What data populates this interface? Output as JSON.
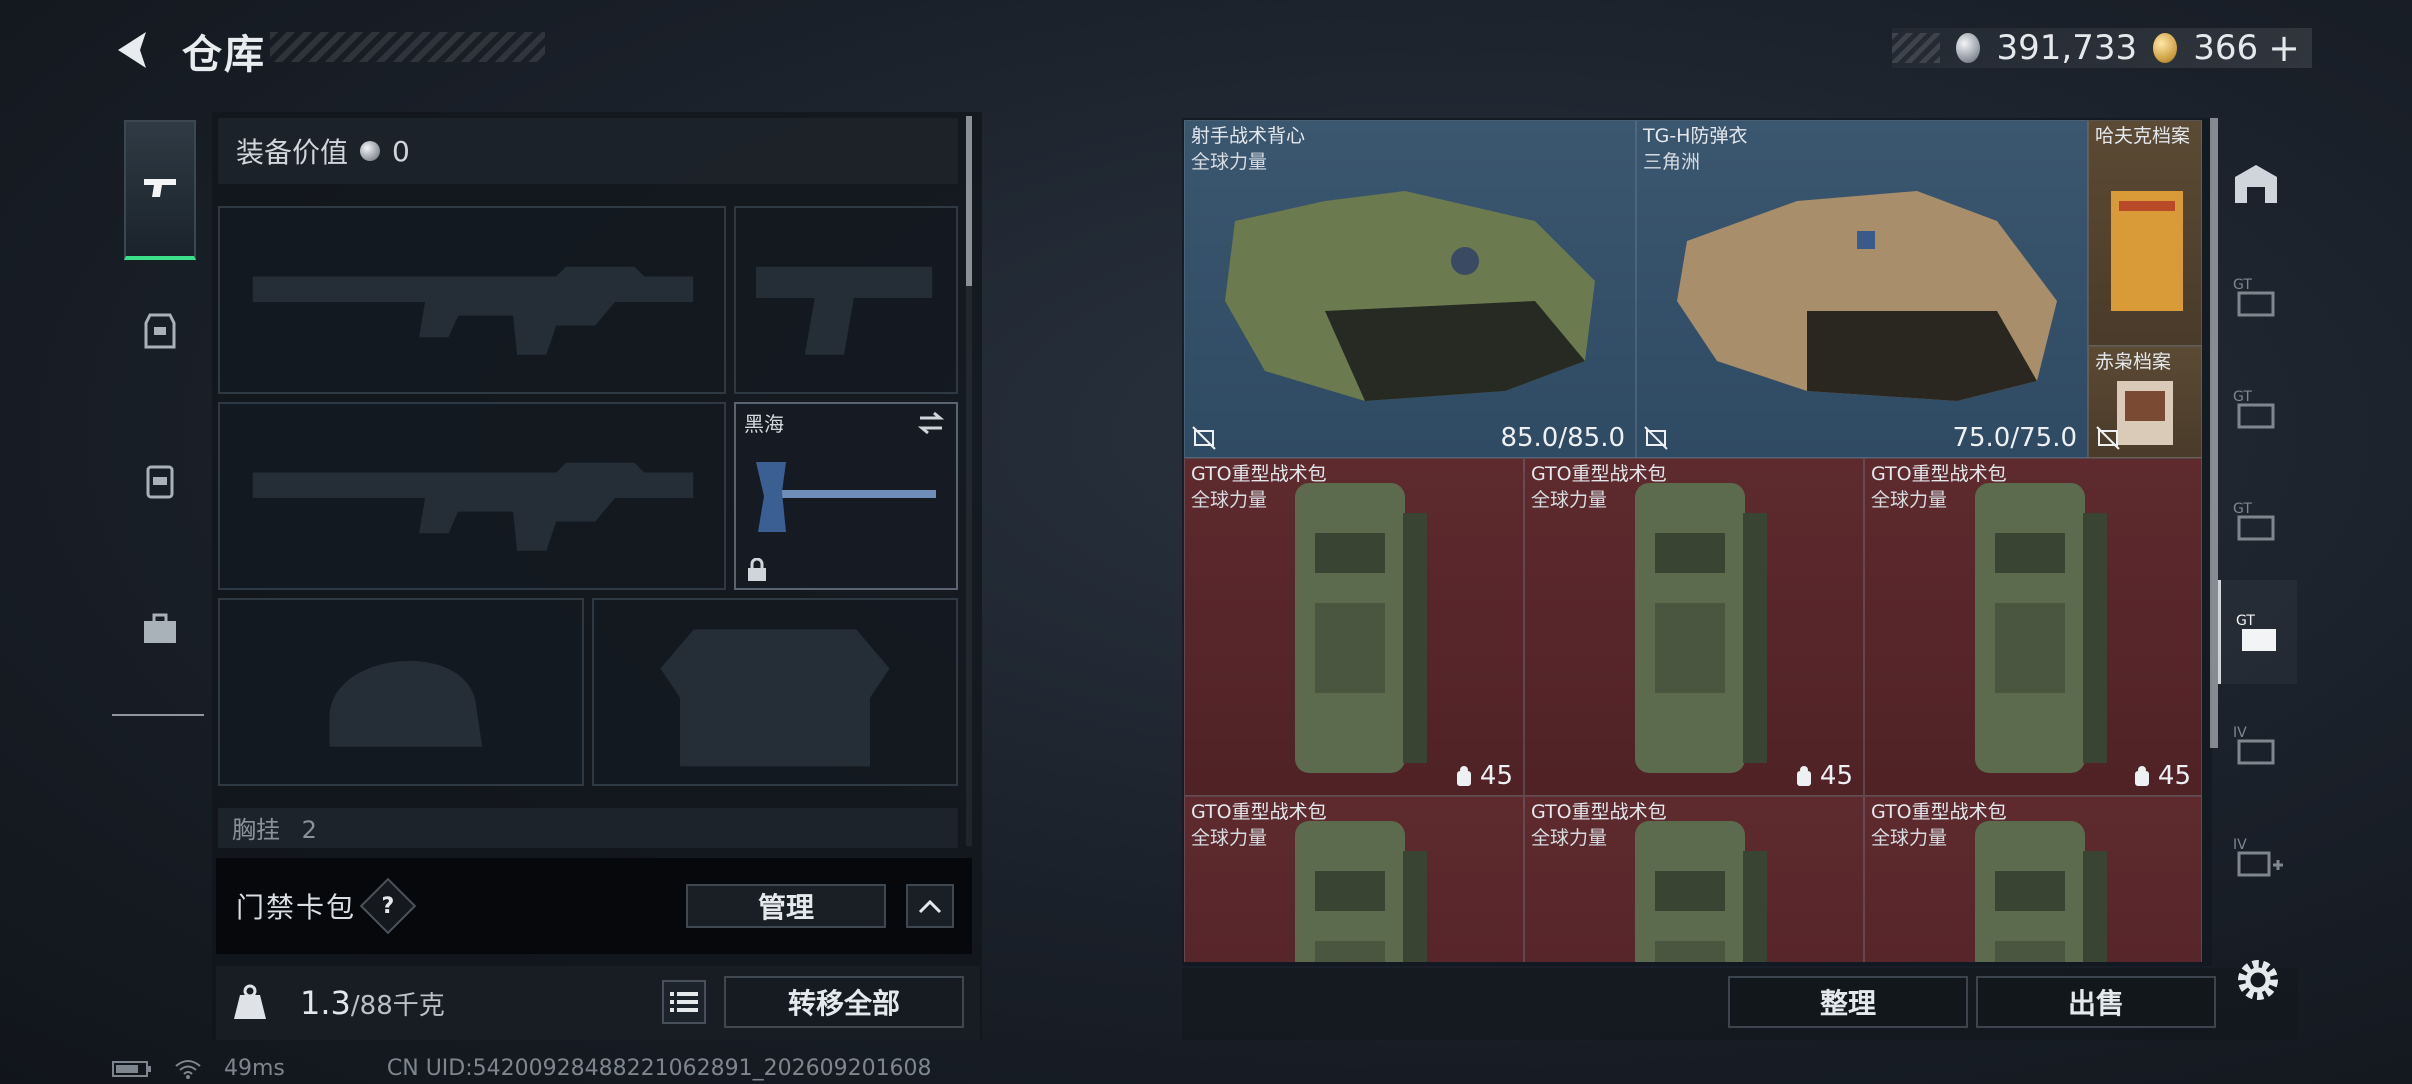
{
  "header": {
    "title": "仓库",
    "currency_silver": "391,733",
    "currency_gold": "366",
    "add_label": "+"
  },
  "loadout": {
    "equip_value_label": "装备价值",
    "equip_value": "0",
    "melee_label": "黑海",
    "chest_label": "胸挂",
    "chest_count": "2"
  },
  "keycard": {
    "label": "门禁卡包",
    "help": "?",
    "manage": "管理"
  },
  "weight": {
    "current": "1.3",
    "max": "/88",
    "unit": "千克",
    "transfer_all": "转移全部"
  },
  "stash": {
    "items": [
      {
        "name": "射手战术背心",
        "sub": "全球力量",
        "value": "85.0/85.0"
      },
      {
        "name": "TG-H防弹衣",
        "sub": "三角洲",
        "value": "75.0/75.0"
      },
      {
        "name": "哈夫克档案",
        "sub": "",
        "value": ""
      },
      {
        "name": "赤枭档案",
        "sub": "",
        "value": ""
      },
      {
        "name": "GTO重型战术包",
        "sub": "全球力量",
        "value": "45"
      },
      {
        "name": "GTO重型战术包",
        "sub": "全球力量",
        "value": "45"
      },
      {
        "name": "GTO重型战术包",
        "sub": "全球力量",
        "value": "45"
      },
      {
        "name": "GTO重型战术包",
        "sub": "全球力量",
        "value": ""
      },
      {
        "name": "GTO重型战术包",
        "sub": "全球力量",
        "value": ""
      },
      {
        "name": "GTO重型战术包",
        "sub": "全球力量",
        "value": ""
      }
    ],
    "sort": "整理",
    "sell": "出售"
  },
  "status": {
    "ping": "49ms",
    "uid": "CN UID:54200928488221062891_202609201608"
  },
  "colors": {
    "accent_green": "#3ce08a",
    "stash_blue": "#3b566f",
    "stash_red": "#5e2a2e"
  }
}
